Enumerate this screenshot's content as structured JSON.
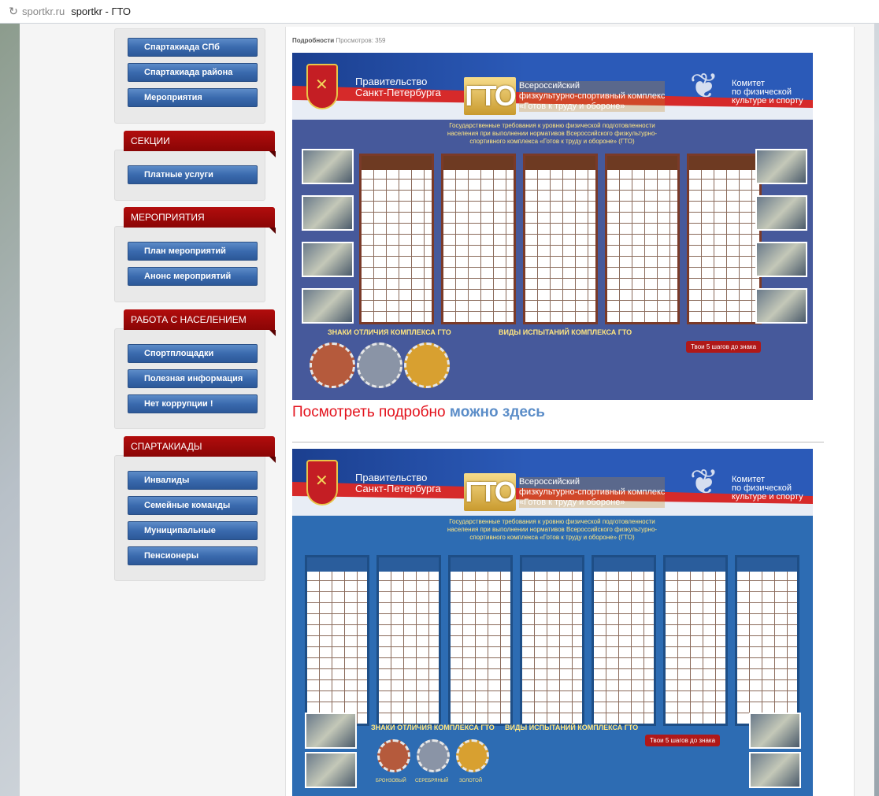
{
  "browser": {
    "host": "sportkr.ru",
    "title": "sportkr - ГТО"
  },
  "sidebar": {
    "top_buttons": [
      {
        "label": "Спартакиада СПб"
      },
      {
        "label": "Спартакиада района"
      },
      {
        "label": "Мероприятия"
      }
    ],
    "sections": [
      {
        "title": "СЕКЦИИ",
        "items": [
          {
            "label": "Платные услуги"
          }
        ]
      },
      {
        "title": "МЕРОПРИЯТИЯ",
        "items": [
          {
            "label": "План мероприятий"
          },
          {
            "label": "Анонс мероприятий"
          }
        ]
      },
      {
        "title": "РАБОТА С НАСЕЛЕНИЕМ",
        "items": [
          {
            "label": "Спортплощадки"
          },
          {
            "label": "Полезная информация"
          },
          {
            "label": "Нет коррупции !"
          }
        ]
      },
      {
        "title": "СПАРТАКИАДЫ",
        "items": [
          {
            "label": "Инвалиды"
          },
          {
            "label": "Семейные команды"
          },
          {
            "label": "Муниципальные"
          },
          {
            "label": "Пенсионеры"
          }
        ]
      }
    ]
  },
  "article": {
    "details_label": "Подробности",
    "views": "Просмотров: 359",
    "more_prefix": "Посмотреть подробно",
    "more_link": "можно здесь"
  },
  "poster": {
    "government": "Правительство\nСанкт-Петербурга",
    "gto": "ГТО",
    "complex": "Всероссийский\nфизкультурно-спортивный комплекс\n«Готов к труду и обороне»",
    "committee": "Комитет\nпо физической\nкультуре и спорту",
    "requirements": "Государственные требования к уровню физической подготовленности населения при выполнении нормативов Всероссийского физкультурно-спортивного комплекса «Готов к труду и обороне» (ГТО)",
    "badges_title": "ЗНАКИ ОТЛИЧИЯ КОМПЛЕКСА ГТО",
    "tests_title": "ВИДЫ ИСПЫТАНИЙ КОМПЛЕКСА ГТО",
    "steps": "Твои 5 шагов до знака",
    "badge_labels": [
      "БРОНЗОВЫЙ",
      "СЕРЕБРЯНЫЙ",
      "ЗОЛОТОЙ"
    ],
    "colors": {
      "bronze": "#b55a3c",
      "silver": "#8a94a6",
      "gold": "#d8a030"
    }
  }
}
